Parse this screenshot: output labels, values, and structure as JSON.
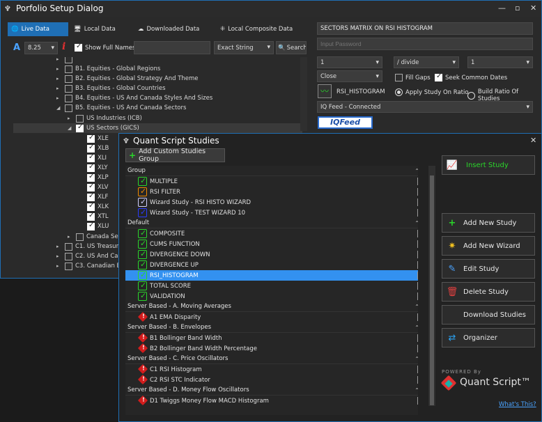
{
  "main": {
    "title": "Porfolio Setup Dialog",
    "tabs": [
      {
        "label": "Live Data",
        "icon": "globe-icon"
      },
      {
        "label": "Local Data",
        "icon": "monitor-icon"
      },
      {
        "label": "Downloaded Data",
        "icon": "cloud-download-icon"
      },
      {
        "label": "Local Composite Data",
        "icon": "composite-icon"
      }
    ],
    "toolbar": {
      "font_size": "8.25",
      "show_full_names": "Show Full Names",
      "search_value": "",
      "match_mode": "Exact String",
      "search_label": "Search"
    },
    "tree": {
      "rows": [
        {
          "label": "B1. Equities - Global Regions"
        },
        {
          "label": "B2. Equities - Global Strategy And Theme"
        },
        {
          "label": "B3. Equities - Global Countries"
        },
        {
          "label": "B4. Equities - US And Canada Styles And Sizes"
        },
        {
          "label": "B5. Equities - US And Canada Sectors"
        },
        {
          "label": "US Industries (ICB)"
        },
        {
          "label": "US Sectors (GICS)"
        },
        {
          "label": "XLE"
        },
        {
          "label": "XLB"
        },
        {
          "label": "XLI"
        },
        {
          "label": "XLY"
        },
        {
          "label": "XLP"
        },
        {
          "label": "XLV"
        },
        {
          "label": "XLF"
        },
        {
          "label": "XLK"
        },
        {
          "label": "XTL"
        },
        {
          "label": "XLU"
        },
        {
          "label": "Canada Sec"
        },
        {
          "label": "C1. US Treasuri"
        },
        {
          "label": "C2. US And Can"
        },
        {
          "label": "C3. Canadian B"
        }
      ]
    },
    "right_panel": {
      "matrix_name": "SECTORS MATRIX ON RSI HISTOGRAM",
      "password_placeholder": "Input Password",
      "param1": "1",
      "operator": "/ divide",
      "param2": "1",
      "price_field": "Close",
      "fill_gaps": "Fill Gaps",
      "seek_common_dates": "Seek Common Dates",
      "study_name": "RSI_HISTOGRAM",
      "apply_on_ratio": "Apply Study On Ratio",
      "build_ratio": "Build Ratio Of Studies",
      "feed_status": "IQ Feed - Connected",
      "feed_logo": "IQFeed"
    }
  },
  "studies": {
    "title": "Quant Script Studies",
    "add_group_label": "Add Custom Studies Group",
    "rows": [
      {
        "type": "group",
        "label": "Group"
      },
      {
        "type": "item",
        "label": "MULTIPLE",
        "icon": "green"
      },
      {
        "type": "item",
        "label": "RSI FILTER",
        "icon": "orange"
      },
      {
        "type": "item",
        "label": "Wizard Study - RSI HISTO WIZARD",
        "icon": "white"
      },
      {
        "type": "item",
        "label": "Wizard Study - TEST WIZARD 10",
        "icon": "navy"
      },
      {
        "type": "group",
        "label": "Default"
      },
      {
        "type": "item",
        "label": "COMPOSITE",
        "icon": "green"
      },
      {
        "type": "item",
        "label": "CUMS FUNCTION",
        "icon": "green"
      },
      {
        "type": "item",
        "label": "DIVERGENCE DOWN",
        "icon": "green"
      },
      {
        "type": "item",
        "label": "DIVERGENCE UP",
        "icon": "green"
      },
      {
        "type": "item",
        "label": "RSI_HISTOGRAM",
        "icon": "green",
        "selected": true
      },
      {
        "type": "item",
        "label": "TOTAL SCORE",
        "icon": "green"
      },
      {
        "type": "item",
        "label": "VALIDATION",
        "icon": "green"
      },
      {
        "type": "group",
        "label": "Server Based - A. Moving Averages"
      },
      {
        "type": "item",
        "label": "A1 EMA Disparity",
        "icon": "red"
      },
      {
        "type": "group",
        "label": "Server Based - B. Envelopes"
      },
      {
        "type": "item",
        "label": "B1 Bollinger Band Width",
        "icon": "red"
      },
      {
        "type": "item",
        "label": "B2 Bollinger Band Width Percentage",
        "icon": "red"
      },
      {
        "type": "group",
        "label": "Server Based - C. Price Oscillators"
      },
      {
        "type": "item",
        "label": "C1 RSI Histogram",
        "icon": "red"
      },
      {
        "type": "item",
        "label": "C2 RSI STC Indicator",
        "icon": "red"
      },
      {
        "type": "group",
        "label": "Server Based - D. Money Flow Oscillators"
      },
      {
        "type": "item",
        "label": "D1 Twiggs Money Flow MACD Histogram",
        "icon": "red"
      }
    ],
    "buttons": {
      "insert": "Insert Study",
      "add_new": "Add New Study",
      "add_wizard": "Add New Wizard",
      "edit": "Edit Study",
      "delete": "Delete Study",
      "download": "Download Studies",
      "organizer": "Organizer"
    },
    "powered_by": "POWERED By",
    "brand": "Quant Script™",
    "whats_this": "What's This?"
  }
}
